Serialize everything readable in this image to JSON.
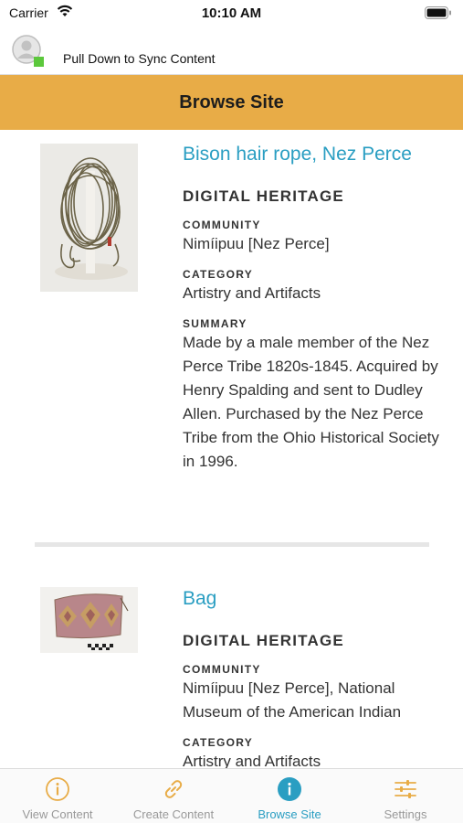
{
  "status_bar": {
    "carrier": "Carrier",
    "time": "10:10 AM"
  },
  "sync_bar": {
    "label": "Pull Down to Sync Content"
  },
  "header": {
    "title": "Browse Site"
  },
  "items": [
    {
      "title": "Bison hair rope, Nez Perce",
      "section": "DIGITAL HERITAGE",
      "community_label": "COMMUNITY",
      "community": "Nimíipuu [Nez Perce]",
      "category_label": "CATEGORY",
      "category": "Artistry and Artifacts",
      "summary_label": "SUMMARY",
      "summary": "Made by a male member of the Nez Perce Tribe 1820s-1845. Acquired by Henry Spalding and sent to Dudley Allen. Purchased by the Nez Perce Tribe from the Ohio Historical Society in 1996."
    },
    {
      "title": "Bag",
      "section": "DIGITAL HERITAGE",
      "community_label": "COMMUNITY",
      "community": "Nimíipuu [Nez Perce], National Museum of the American Indian",
      "category_label": "CATEGORY",
      "category": "Artistry and Artifacts"
    }
  ],
  "tabs": [
    {
      "label": "View Content",
      "icon": "info-circle-icon",
      "active": false
    },
    {
      "label": "Create Content",
      "icon": "link-icon",
      "active": false
    },
    {
      "label": "Browse Site",
      "icon": "info-filled-icon",
      "active": true
    },
    {
      "label": "Settings",
      "icon": "sliders-icon",
      "active": false
    }
  ],
  "colors": {
    "accent": "#e8ac47",
    "link": "#2a9ec2",
    "inactive_tab": "#999999",
    "online": "#5cc83c"
  }
}
